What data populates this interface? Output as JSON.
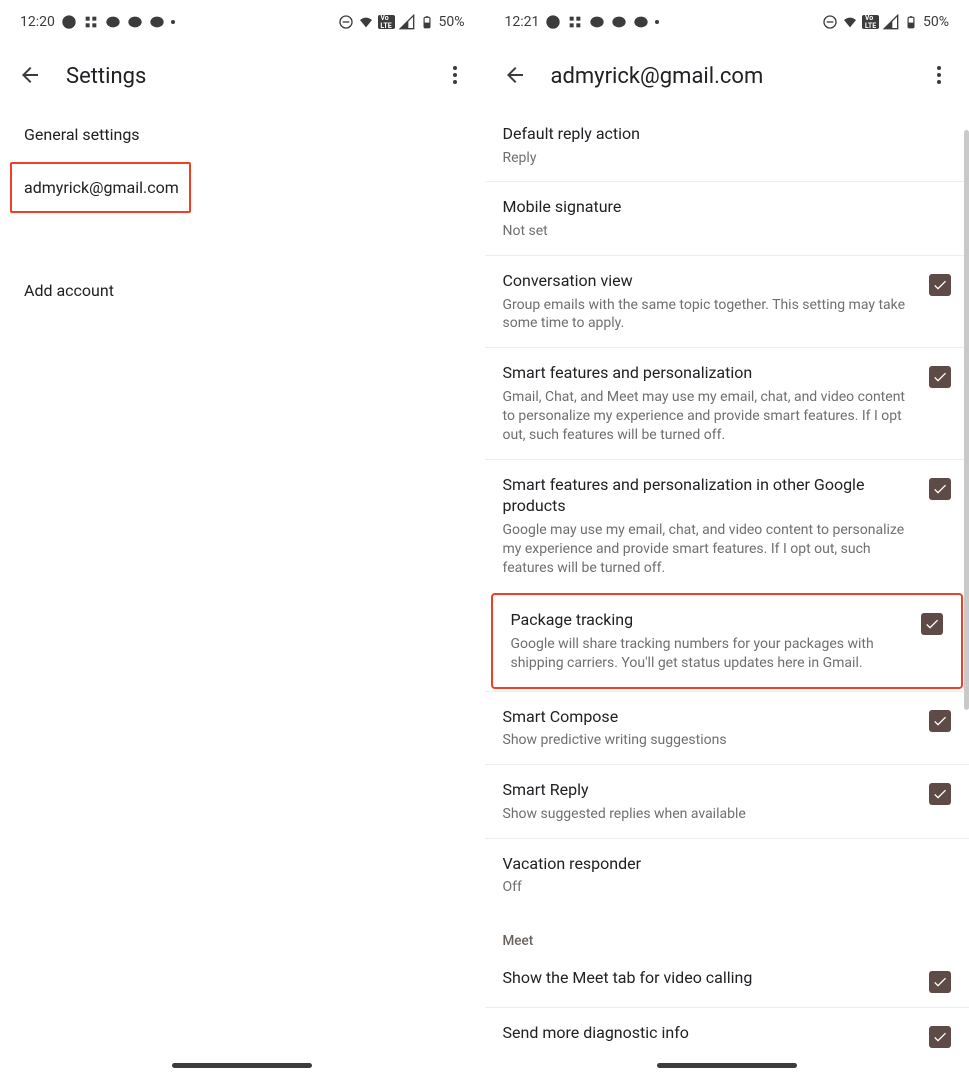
{
  "left": {
    "status": {
      "time": "12:20",
      "battery": "50%"
    },
    "title": "Settings",
    "items": {
      "general": "General settings",
      "account": "admyrick@gmail.com",
      "add": "Add account"
    }
  },
  "right": {
    "status": {
      "time": "12:21",
      "battery": "50%"
    },
    "title": "admyrick@gmail.com",
    "section_meet": "Meet",
    "settings": {
      "default_reply": {
        "title": "Default reply action",
        "sub": "Reply"
      },
      "signature": {
        "title": "Mobile signature",
        "sub": "Not set"
      },
      "conversation": {
        "title": "Conversation view",
        "sub": "Group emails with the same topic together. This setting may take some time to apply."
      },
      "smart_features": {
        "title": "Smart features and personalization",
        "sub": "Gmail, Chat, and Meet may use my email, chat, and video content to personalize my experience and provide smart features. If I opt out, such features will be turned off."
      },
      "smart_features_other": {
        "title": "Smart features and personalization in other Google products",
        "sub": "Google may use my email, chat, and video content to personalize my experience and provide smart features. If I opt out, such features will be turned off."
      },
      "package_tracking": {
        "title": "Package tracking",
        "sub": "Google will share tracking numbers for your packages with shipping carriers. You'll get status updates here in Gmail."
      },
      "smart_compose": {
        "title": "Smart Compose",
        "sub": "Show predictive writing suggestions"
      },
      "smart_reply": {
        "title": "Smart Reply",
        "sub": "Show suggested replies when available"
      },
      "vacation": {
        "title": "Vacation responder",
        "sub": "Off"
      },
      "meet_tab": {
        "title": "Show the Meet tab for video calling"
      },
      "diagnostic": {
        "title": "Send more diagnostic info"
      }
    }
  }
}
